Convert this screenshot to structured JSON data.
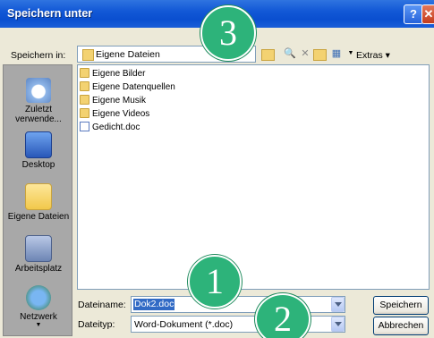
{
  "window": {
    "title": "Speichern unter"
  },
  "toolbar": {
    "save_in_label": "Speichern in:",
    "location_value": "Eigene Dateien",
    "extras_label": "Extras"
  },
  "places": [
    {
      "label": "Zuletzt verwende..."
    },
    {
      "label": "Desktop"
    },
    {
      "label": "Eigene Dateien"
    },
    {
      "label": "Arbeitsplatz"
    },
    {
      "label": "Netzwerk"
    }
  ],
  "files": [
    {
      "name": "Eigene Bilder",
      "icon": "folder-icon"
    },
    {
      "name": "Eigene Datenquellen",
      "icon": "folder-icon"
    },
    {
      "name": "Eigene Musik",
      "icon": "folder-icon"
    },
    {
      "name": "Eigene Videos",
      "icon": "folder-icon"
    },
    {
      "name": "Gedicht.doc",
      "icon": "word-document-icon"
    }
  ],
  "form": {
    "filename_label": "Dateiname:",
    "filename_value": "Dok2.doc",
    "filetype_label": "Dateityp:",
    "filetype_value": "Word-Dokument (*.doc)"
  },
  "buttons": {
    "save": "Speichern",
    "cancel": "Abbrechen"
  },
  "annotations": {
    "one": "1",
    "two": "2",
    "three": "3"
  },
  "colors": {
    "titlebar": "#0a4fd0",
    "badge": "#2db37a",
    "selection": "#316ac5"
  }
}
